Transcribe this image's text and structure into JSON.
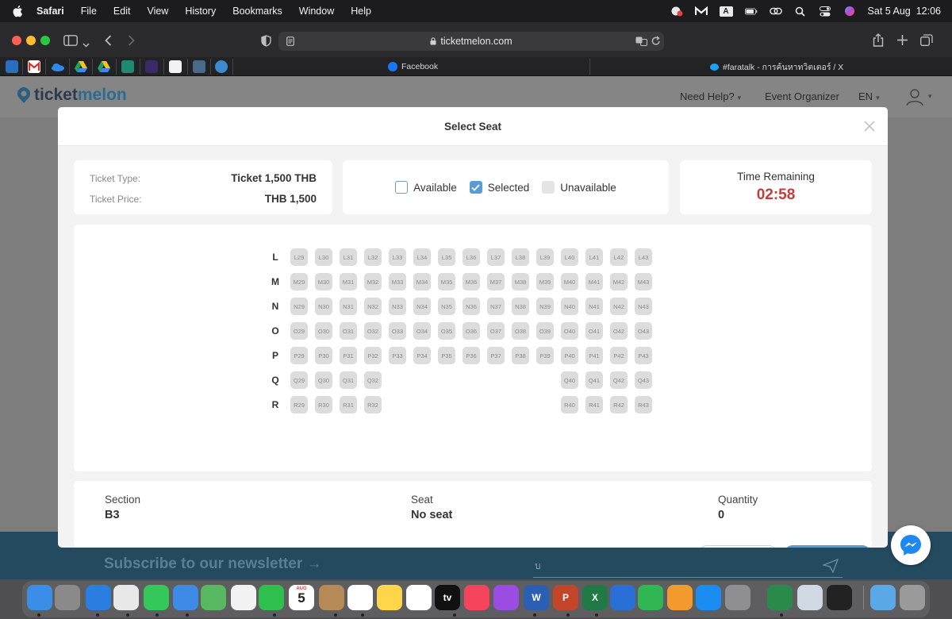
{
  "menubar": {
    "app_name": "Safari",
    "items": [
      "File",
      "Edit",
      "View",
      "History",
      "Bookmarks",
      "Window",
      "Help"
    ],
    "input_indicator": "A",
    "datetime": "Sat 5 Aug  12:06"
  },
  "browser": {
    "url": "ticketmelon.com",
    "tabs": [
      {
        "label": "Facebook"
      },
      {
        "label": "#faratalk - การค้นหาทวิตเตอร์ / X"
      }
    ]
  },
  "site": {
    "logo_part1": "ticket",
    "logo_part2": "melon",
    "nav": [
      {
        "label": "Need Help?",
        "has_caret": true
      },
      {
        "label": "Event Organizer",
        "has_caret": false
      },
      {
        "label": "EN",
        "has_caret": true
      }
    ],
    "newsletter_text": "Subscribe to our newsletter →",
    "newsletter_input_value": "บ"
  },
  "modal": {
    "title": "Select Seat",
    "ticket_type_label": "Ticket Type:",
    "ticket_type_value": "Ticket 1,500 THB",
    "ticket_price_label": "Ticket Price:",
    "ticket_price_value": "THB 1,500",
    "legend": {
      "available": "Available",
      "selected": "Selected",
      "unavailable": "Unavailable"
    },
    "time_label": "Time Remaining",
    "time_value": "02:58",
    "seat_rows": [
      {
        "row": "L",
        "seats": [
          "L29",
          "L30",
          "L31",
          "L32",
          "L33",
          "L34",
          "L35",
          "L36",
          "L37",
          "L38",
          "L39",
          "L40",
          "L41",
          "L42",
          "L43"
        ]
      },
      {
        "row": "M",
        "seats": [
          "M29",
          "M30",
          "M31",
          "M32",
          "M33",
          "M34",
          "M35",
          "M36",
          "M37",
          "M38",
          "M39",
          "M40",
          "M41",
          "M42",
          "M43"
        ]
      },
      {
        "row": "N",
        "seats": [
          "N29",
          "N30",
          "N31",
          "N32",
          "N33",
          "N34",
          "N35",
          "N36",
          "N37",
          "N38",
          "N39",
          "N40",
          "N41",
          "N42",
          "N43"
        ]
      },
      {
        "row": "O",
        "seats": [
          "O29",
          "O30",
          "O31",
          "O32",
          "O33",
          "O34",
          "O35",
          "O36",
          "O37",
          "O38",
          "O39",
          "O40",
          "O41",
          "O42",
          "O43"
        ]
      },
      {
        "row": "P",
        "seats": [
          "P29",
          "P30",
          "P31",
          "P32",
          "P33",
          "P34",
          "P35",
          "P36",
          "P37",
          "P38",
          "P39",
          "P40",
          "P41",
          "P42",
          "P43"
        ]
      },
      {
        "row": "Q",
        "seats": [
          "Q29",
          "Q30",
          "Q31",
          "Q32",
          null,
          null,
          null,
          null,
          null,
          null,
          null,
          "Q40",
          "Q41",
          "Q42",
          "Q43"
        ]
      },
      {
        "row": "R",
        "seats": [
          "R29",
          "R30",
          "R31",
          "R32",
          null,
          null,
          null,
          null,
          null,
          null,
          null,
          "R40",
          "R41",
          "R42",
          "R43"
        ]
      }
    ],
    "seat_status": "unavailable",
    "summary": {
      "section_label": "Section",
      "section_value": "B3",
      "seat_label": "Seat",
      "seat_value": "No seat",
      "quantity_label": "Quantity",
      "quantity_value": "0"
    }
  },
  "colors": {
    "accent": "#5b9bd5",
    "timer": "#c93b3b",
    "seat_unavailable": "#dcdcdc",
    "newsletter_bg": "#234a5f"
  },
  "dock": {
    "calendar_month": "AUG",
    "calendar_day": "5",
    "tv_label": "tv"
  }
}
